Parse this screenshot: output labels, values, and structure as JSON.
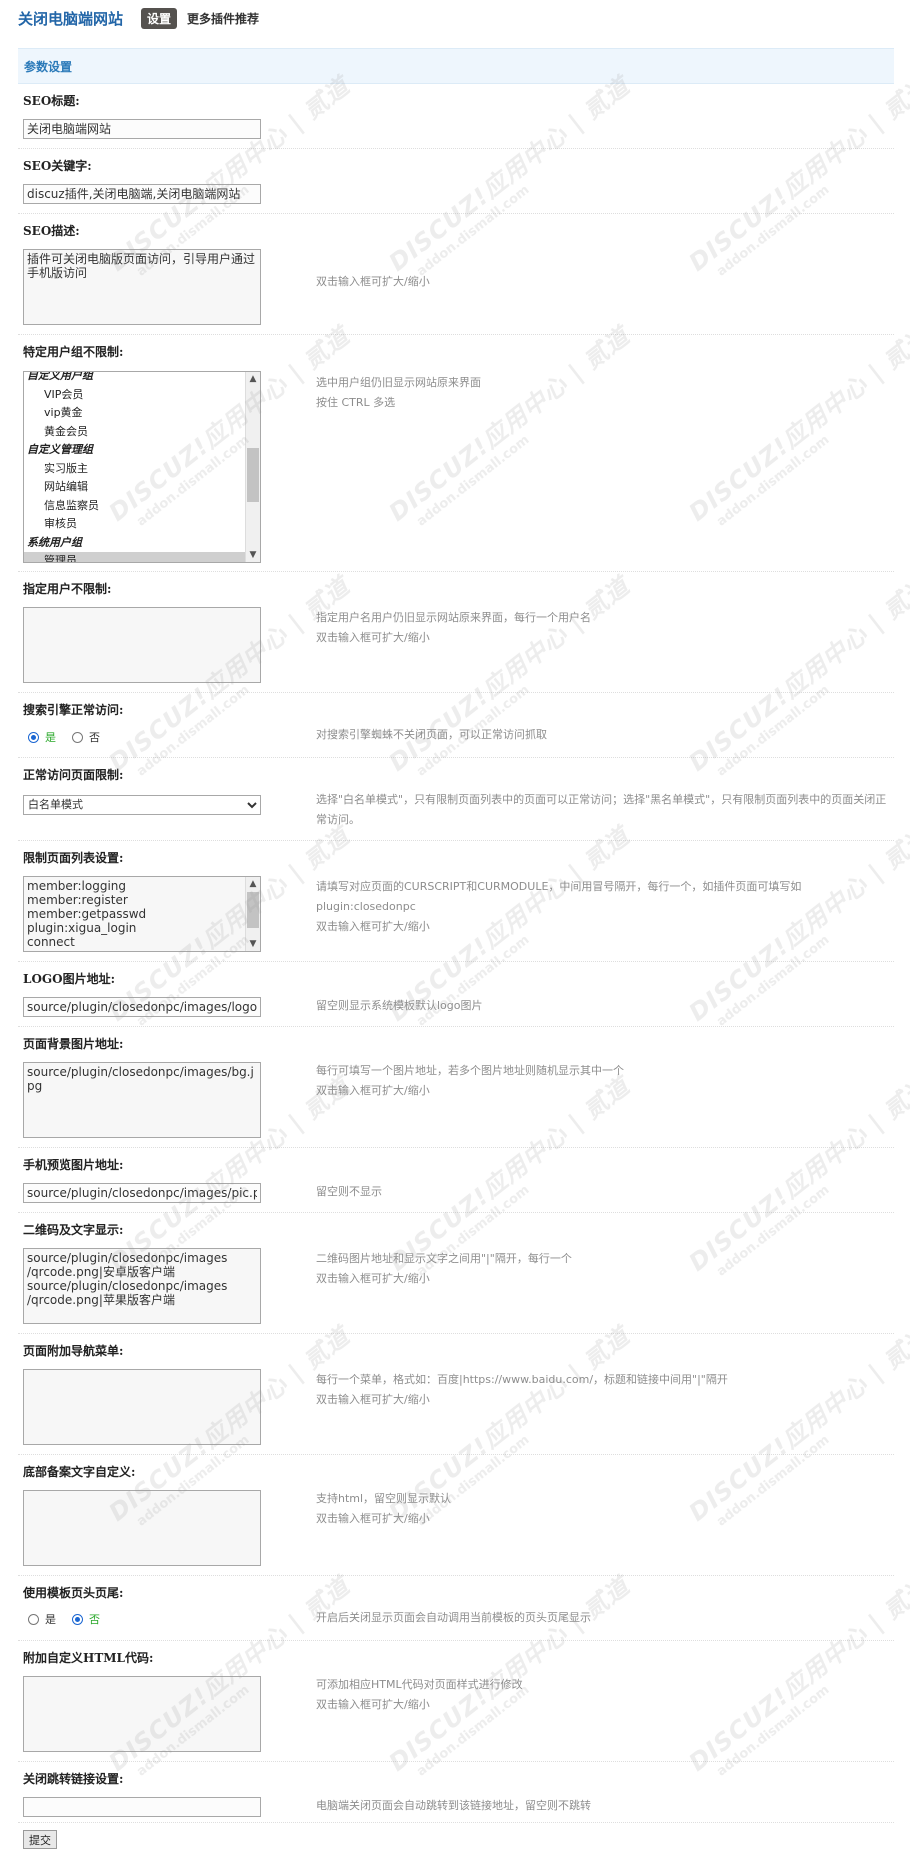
{
  "header": {
    "plugin_title": "关闭电脑端网站",
    "tab_settings": "设置",
    "tab_more": "更多插件推荐"
  },
  "section": {
    "title": "参数设置"
  },
  "fields": {
    "seo_title": {
      "label": "SEO标题:",
      "value": "关闭电脑端网站"
    },
    "seo_keywords": {
      "label": "SEO关键字:",
      "value": "discuz插件,关闭电脑端,关闭电脑端网站"
    },
    "seo_description": {
      "label": "SEO描述:",
      "value": "插件可关闭电脑版页面访问，引导用户通过手机版访问",
      "tip": "双击输入框可扩大/缩小"
    },
    "user_groups": {
      "label": "特定用户组不限制:",
      "tip1": "选中用户组仍旧显示网站原来界面",
      "tip2": "按住 CTRL 多选",
      "items": [
        {
          "type": "group",
          "text": "自定义用户组"
        },
        {
          "type": "option",
          "text": "VIP会员"
        },
        {
          "type": "option",
          "text": "vip黄金"
        },
        {
          "type": "option",
          "text": "黄金会员"
        },
        {
          "type": "group",
          "text": "自定义管理组"
        },
        {
          "type": "option",
          "text": "实习版主"
        },
        {
          "type": "option",
          "text": "网站编辑"
        },
        {
          "type": "option",
          "text": "信息监察员"
        },
        {
          "type": "option",
          "text": "审核员"
        },
        {
          "type": "group",
          "text": "系统用户组"
        },
        {
          "type": "option",
          "text": "管理员",
          "selected": true
        }
      ]
    },
    "users": {
      "label": "指定用户不限制:",
      "tip1": "指定用户名用户仍旧显示网站原来界面，每行一个用户名",
      "tip2": "双击输入框可扩大/缩小"
    },
    "search_engine": {
      "label": "搜索引擎正常访问:",
      "yes": "是",
      "no": "否",
      "tip": "对搜索引擎蜘蛛不关闭页面，可以正常访问抓取"
    },
    "page_limit": {
      "label": "正常访问页面限制:",
      "selected": "白名单模式",
      "tip": "选择\"白名单模式\"，只有限制页面列表中的页面可以正常访问；选择\"黑名单模式\"，只有限制页面列表中的页面关闭正常访问。"
    },
    "page_list": {
      "label": "限制页面列表设置:",
      "lines": [
        "member:logging",
        "member:register",
        "member:getpasswd",
        "plugin:xigua_login",
        "connect"
      ],
      "tip1": "请填写对应页面的CURSCRIPT和CURMODULE，中间用冒号隔开，每行一个，如插件页面可填写如plugin:closedonpc",
      "tip2": "双击输入框可扩大/缩小"
    },
    "logo": {
      "label": "LOGO图片地址:",
      "value": "source/plugin/closedonpc/images/logo.png",
      "tip": "留空则显示系统模板默认logo图片"
    },
    "bg_image": {
      "label": "页面背景图片地址:",
      "value": "source/plugin/closedonpc/images/bg.jpg",
      "tip1": "每行可填写一个图片地址，若多个图片地址则随机显示其中一个",
      "tip2": "双击输入框可扩大/缩小"
    },
    "mobile_preview": {
      "label": "手机预览图片地址:",
      "value": "source/plugin/closedonpc/images/pic.png",
      "tip": "留空则不显示"
    },
    "qrcode": {
      "label": "二维码及文字显示:",
      "lines": [
        "source/plugin/closedonpc/images",
        "/qrcode.png|安卓版客户端",
        "source/plugin/closedonpc/images",
        "/qrcode.png|苹果版客户端"
      ],
      "tip1": "二维码图片地址和显示文字之间用\"|\"隔开，每行一个",
      "tip2": "双击输入框可扩大/缩小"
    },
    "nav_menu": {
      "label": "页面附加导航菜单:",
      "tip1": "每行一个菜单，格式如：百度|https://www.baidu.com/，标题和链接中间用\"|\"隔开",
      "tip2": "双击输入框可扩大/缩小"
    },
    "footer_text": {
      "label": "底部备案文字自定义:",
      "tip1": "支持html，留空则显示默认",
      "tip2": "双击输入框可扩大/缩小"
    },
    "template_header": {
      "label": "使用模板页头页尾:",
      "yes": "是",
      "no": "否",
      "tip": "开启后关闭显示页面会自动调用当前模板的页头页尾显示"
    },
    "custom_html": {
      "label": "附加自定义HTML代码:",
      "tip1": "可添加相应HTML代码对页面样式进行修改",
      "tip2": "双击输入框可扩大/缩小"
    },
    "redirect": {
      "label": "关闭跳转链接设置:",
      "value": "",
      "tip": "电脑端关闭页面会自动跳转到该链接地址，留空则不跳转"
    }
  },
  "submit_label": "提交",
  "watermark": {
    "brand": "DISCUZ!应用中心 | 贰道",
    "domain": "addon.dismall.com"
  }
}
